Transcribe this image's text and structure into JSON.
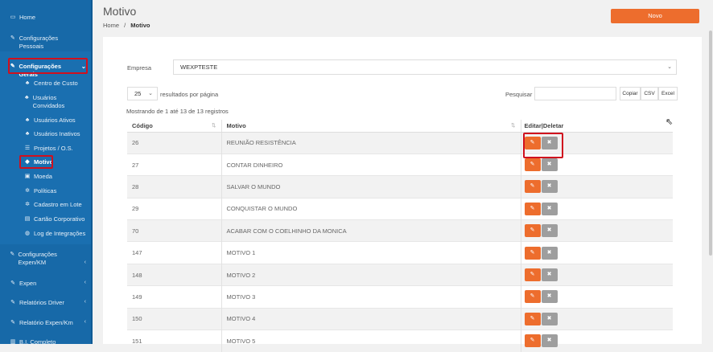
{
  "sidebar": {
    "items": [
      {
        "icon": "monitor-icon",
        "label": "Home"
      },
      {
        "icon": "edit-icon",
        "label": "Configurações Pessoais"
      },
      {
        "icon": "edit-icon",
        "label": "Configurações Gerais",
        "caret": "⌄"
      },
      {
        "icon": "users-icon",
        "label": "Centro de Custo"
      },
      {
        "icon": "users-icon",
        "label": "Usuários Convidados"
      },
      {
        "icon": "users-icon",
        "label": "Usuários Ativos"
      },
      {
        "icon": "users-icon",
        "label": "Usuários Inativos"
      },
      {
        "icon": "list-icon",
        "label": "Projetos / O.S."
      },
      {
        "icon": "tag-icon",
        "label": "Motivo"
      },
      {
        "icon": "money-icon",
        "label": "Moeda"
      },
      {
        "icon": "gear-icon",
        "label": "Políticas"
      },
      {
        "icon": "gears-icon",
        "label": "Cadastro em Lote"
      },
      {
        "icon": "card-icon",
        "label": "Cartão Corporativo"
      },
      {
        "icon": "globe-icon",
        "label": "Log de Integrações"
      },
      {
        "icon": "edit-icon",
        "label": "Configurações Expen/KM",
        "caret": "‹"
      },
      {
        "icon": "edit-icon",
        "label": "Expen",
        "caret": "‹"
      },
      {
        "icon": "edit-icon",
        "label": "Relatórios Driver",
        "caret": "‹"
      },
      {
        "icon": "edit-icon",
        "label": "Relatório Expen/Km",
        "caret": "‹"
      },
      {
        "icon": "chart-icon",
        "label": "B.I. Completo"
      }
    ]
  },
  "header": {
    "title": "Motivo",
    "breadcrumb_home": "Home",
    "breadcrumb_sep": "/",
    "breadcrumb_current": "Motivo",
    "new_button": "Novo"
  },
  "filters": {
    "empresa_label": "Empresa",
    "empresa_value": "WEXPTESTE",
    "page_size": "25",
    "page_size_label": "resultados por página",
    "search_label": "Pesquisar",
    "export_copy": "Copiar",
    "export_csv": "CSV",
    "export_excel": "Excel",
    "info": "Mostrando de 1 até 13 de 13 registros"
  },
  "table": {
    "headers": [
      "Código",
      "Motivo",
      "Editar|Deletar"
    ],
    "rows": [
      {
        "code": "26",
        "motivo": "REUNIÃO RESISTÊNCIA"
      },
      {
        "code": "27",
        "motivo": "CONTAR DINHEIRO"
      },
      {
        "code": "28",
        "motivo": "SALVAR O MUNDO"
      },
      {
        "code": "29",
        "motivo": "CONQUISTAR O MUNDO"
      },
      {
        "code": "70",
        "motivo": "ACABAR COM O COELHINHO DA MONICA"
      },
      {
        "code": "147",
        "motivo": "MOTIVO 1"
      },
      {
        "code": "148",
        "motivo": "MOTIVO 2"
      },
      {
        "code": "149",
        "motivo": "MOTIVO 3"
      },
      {
        "code": "150",
        "motivo": "MOTIVO 4"
      },
      {
        "code": "151",
        "motivo": "MOTIVO 5"
      }
    ]
  },
  "colors": {
    "sidebar": "#1769a8",
    "accent": "#ed6d2d",
    "highlight": "#d0101e",
    "delete": "#9e9e9e"
  }
}
